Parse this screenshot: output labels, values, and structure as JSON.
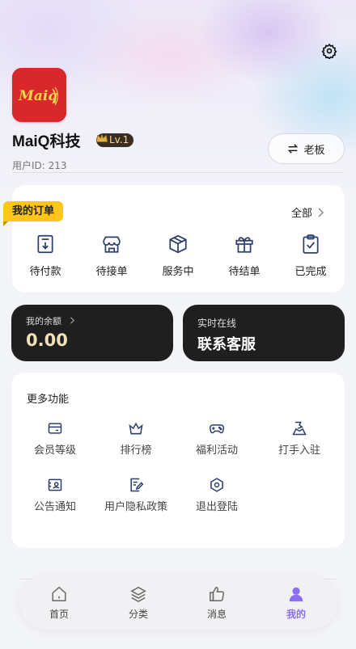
{
  "header": {
    "app_name": "MaiQ科技",
    "logo_text": "Maiq",
    "level": "Lv.1",
    "user_id_label": "用户ID: 213",
    "role_switch_label": "老板",
    "icons": {
      "settings": "gear-icon",
      "switch": "swap-icon",
      "crown": "crown-icon"
    }
  },
  "orders": {
    "title": "我的订单",
    "all_label": "全部",
    "items": [
      {
        "label": "待付款",
        "icon": "payment-icon"
      },
      {
        "label": "待接单",
        "icon": "shop-icon"
      },
      {
        "label": "服务中",
        "icon": "box-icon"
      },
      {
        "label": "待结单",
        "icon": "gift-icon"
      },
      {
        "label": "已完成",
        "icon": "clipboard-check-icon"
      }
    ]
  },
  "balance": {
    "label": "我的余额",
    "value": "0.00"
  },
  "service": {
    "label": "实时在线",
    "value": "联系客服"
  },
  "more": {
    "title": "更多功能",
    "items": [
      {
        "label": "会员等级",
        "icon": "card-icon"
      },
      {
        "label": "排行榜",
        "icon": "crown-icon"
      },
      {
        "label": "福利活动",
        "icon": "gamepad-icon"
      },
      {
        "label": "打手入驻",
        "icon": "user-badge-icon"
      },
      {
        "label": "公告通知",
        "icon": "notice-icon"
      },
      {
        "label": "用户隐私政策",
        "icon": "document-edit-icon"
      },
      {
        "label": "退出登陆",
        "icon": "logout-icon"
      }
    ]
  },
  "tabbar": {
    "items": [
      {
        "label": "首页",
        "icon": "home-icon"
      },
      {
        "label": "分类",
        "icon": "layers-icon"
      },
      {
        "label": "消息",
        "icon": "thumbs-up-icon"
      },
      {
        "label": "我的",
        "icon": "person-icon",
        "active": true
      }
    ]
  },
  "colors": {
    "accent": "#8c6ef2",
    "tag": "#ffc61a",
    "brand_red": "#d8282b",
    "dark_card": "#1f1f1f",
    "balance_gold": "#f2e0b8",
    "icon_blue": "#2c3e6b"
  }
}
